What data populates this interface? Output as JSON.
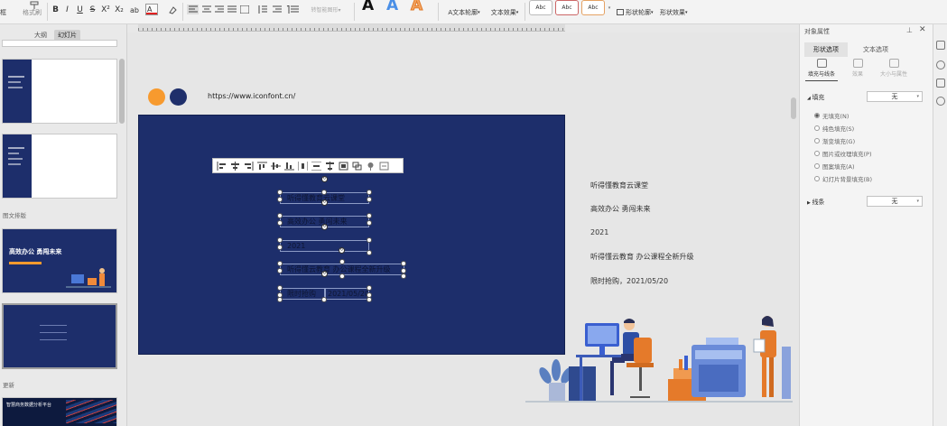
{
  "ribbon": {
    "partial_label": "框",
    "format_painter_label": "格式刷",
    "text_effect_label": "文本轮廓",
    "text_effects_label": "文本效果",
    "shape_outline_label": "形状轮廓",
    "shape_effect_label": "形状效果",
    "style_sample": "Abc",
    "wordart": [
      "A",
      "A",
      "A"
    ],
    "font_buttons": [
      "B",
      "I",
      "U",
      "S",
      "X²",
      "X₂"
    ]
  },
  "left_panel": {
    "tabs": [
      "大纲",
      "幻灯片"
    ],
    "sections": [
      "图文排版",
      "更新"
    ],
    "thumb_title": "高效办公 勇闯未来",
    "thumb_bottom_text": "智慧商务数据分析平台"
  },
  "slide": {
    "url": "https://www.iconfont.cn/",
    "boxes": [
      "听得懂教育云课堂",
      "高效办公 勇闯未来",
      "2021",
      "听得懂云教育 办公课程全新升级",
      "限时抢购",
      "2021/05/20"
    ],
    "side_texts": [
      "听得懂教育云课堂",
      "高效办公 勇闯未来",
      "2021",
      "听得懂云教育 办公课程全新升级",
      "限时抢购，2021/05/20"
    ],
    "colors": {
      "slide_bg": "#1d2e6b",
      "orange": "#f79a2e",
      "navy": "#1f2f6b"
    }
  },
  "right_panel": {
    "title": "对象属性",
    "tabs": [
      "形状选项",
      "文本选项"
    ],
    "subtabs": [
      "填充与线条",
      "效果",
      "大小与属性"
    ],
    "fill_section": "填充",
    "fill_value": "无",
    "fill_options": [
      "无填充(N)",
      "纯色填充(S)",
      "渐变填充(G)",
      "图片或纹理填充(P)",
      "图案填充(A)",
      "幻灯片背景填充(B)"
    ],
    "line_section": "线条",
    "line_value": "无"
  }
}
